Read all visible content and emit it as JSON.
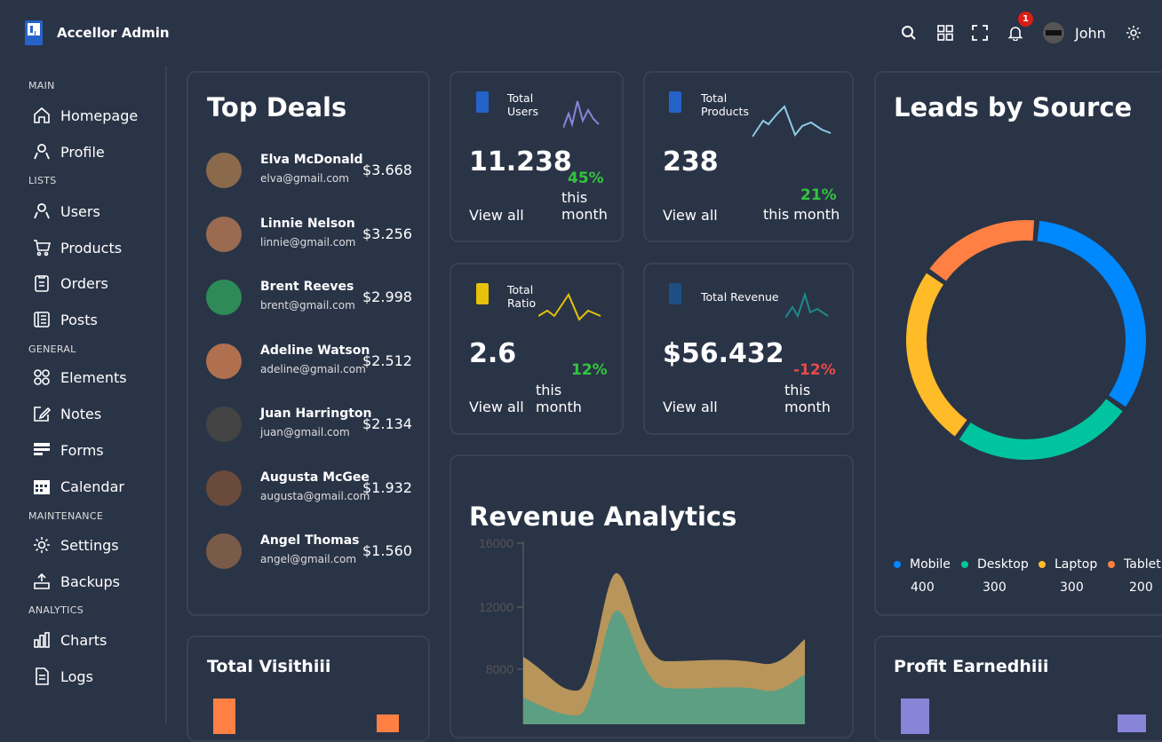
{
  "app": {
    "title": "Accellor Admin",
    "user": "John",
    "notifications": "1"
  },
  "sidebar": {
    "sections": [
      "MAIN",
      "LISTS",
      "GENERAL",
      "MAINTENANCE",
      "ANALYTICS"
    ],
    "items": [
      "Homepage",
      "Profile",
      "Users",
      "Products",
      "Orders",
      "Posts",
      "Elements",
      "Notes",
      "Forms",
      "Calendar",
      "Settings",
      "Backups",
      "Charts",
      "Logs"
    ]
  },
  "top_deals": {
    "title": "Top Deals",
    "rows": [
      {
        "name": "Elva McDonald",
        "email": "elva@gmail.com",
        "amount": "$3.668"
      },
      {
        "name": "Linnie Nelson",
        "email": "linnie@gmail.com",
        "amount": "$3.256"
      },
      {
        "name": "Brent Reeves",
        "email": "brent@gmail.com",
        "amount": "$2.998"
      },
      {
        "name": "Adeline Watson",
        "email": "adeline@gmail.com",
        "amount": "$2.512"
      },
      {
        "name": "Juan Harrington",
        "email": "juan@gmail.com",
        "amount": "$2.134"
      },
      {
        "name": "Augusta McGee",
        "email": "augusta@gmail.com",
        "amount": "$1.932"
      },
      {
        "name": "Angel Thomas",
        "email": "angel@gmail.com",
        "amount": "$1.560"
      }
    ]
  },
  "stats": {
    "users": {
      "label1": "Total",
      "label2": "Users",
      "value": "11.238",
      "pct": "45%",
      "month1": "this",
      "month2": "month",
      "view": "View all",
      "color": "#8884d8"
    },
    "products": {
      "label1": "Total",
      "label2": "Products",
      "value": "238",
      "pct": "21%",
      "month1": "this month",
      "view": "View all",
      "color": "#8ecae6"
    },
    "ratio": {
      "label1": "Total",
      "label2": "Ratio",
      "value": "2.6",
      "pct": "12%",
      "month1": "this",
      "month2": "month",
      "view": "View all",
      "color": "#e7c10b"
    },
    "revenue": {
      "label1": "Total Revenue",
      "value": "$56.432",
      "pct": "-12%",
      "month1": "this",
      "month2": "month",
      "view": "View all",
      "color": "#1c8a8a"
    }
  },
  "leads": {
    "title": "Leads by Source",
    "items": [
      {
        "name": "Mobile",
        "value": "400",
        "color": "#0088fe"
      },
      {
        "name": "Desktop",
        "value": "300",
        "color": "#00c49f"
      },
      {
        "name": "Laptop",
        "value": "300",
        "color": "#ffbb28"
      },
      {
        "name": "Tablet",
        "value": "200",
        "color": "#ff8042"
      }
    ]
  },
  "revenue_analytics": {
    "title": "Revenue Analytics",
    "ticks": [
      "16000",
      "12000",
      "8000"
    ]
  },
  "total_visit": {
    "title": "Total Visithiii"
  },
  "profit": {
    "title": "Profit Earnedhiii"
  },
  "chart_data": {
    "type": "pie",
    "title": "Leads by Source",
    "categories": [
      "Mobile",
      "Desktop",
      "Laptop",
      "Tablet"
    ],
    "values": [
      400,
      300,
      300,
      200
    ]
  }
}
